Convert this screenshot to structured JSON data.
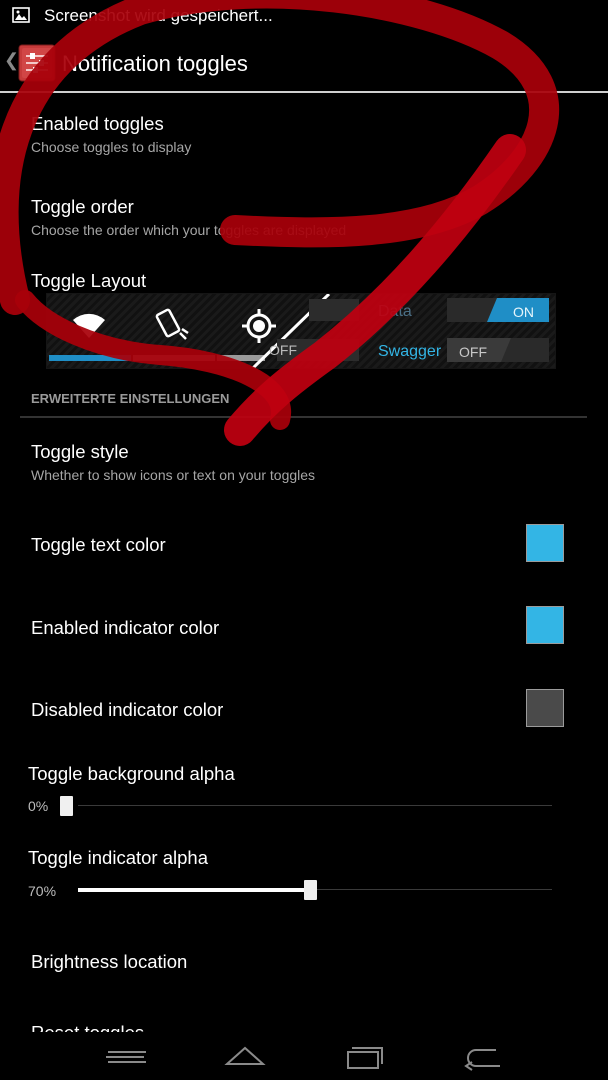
{
  "status_bar": {
    "notification_icon": "image-icon",
    "text": "Screenshot wird gespeichert..."
  },
  "action_bar": {
    "back_icon": "chevron-left-icon",
    "app_icon": "settings-sliders-icon",
    "title": "Notification toggles"
  },
  "prefs": {
    "enabled_toggles": {
      "title": "Enabled toggles",
      "summary": "Choose toggles to display"
    },
    "toggle_order": {
      "title": "Toggle order",
      "summary": "Choose the order which your toggles are displayed"
    },
    "toggle_layout": {
      "title": "Toggle Layout"
    }
  },
  "layout_preview": {
    "icons": [
      "wifi-icon",
      "rotation-icon",
      "location-icon"
    ],
    "off_label_1": "OFF",
    "data_label": "Data",
    "data_state": "ON",
    "swagger_label": "Swagger",
    "swagger_state": "OFF"
  },
  "advanced": {
    "header": "ERWEITERTE EINSTELLUNGEN",
    "toggle_style": {
      "title": "Toggle style",
      "summary": "Whether to show icons or text on your toggles"
    },
    "toggle_text_color": {
      "title": "Toggle text color",
      "color": "#33b5e5"
    },
    "enabled_indicator_color": {
      "title": "Enabled indicator color",
      "color": "#33b5e5"
    },
    "disabled_indicator_color": {
      "title": "Disabled indicator color",
      "color": "#4a4a4a"
    },
    "background_alpha": {
      "title": "Toggle background alpha",
      "value_label": "0%",
      "value": 0
    },
    "indicator_alpha": {
      "title": "Toggle indicator alpha",
      "value_label": "70%",
      "value": 70
    },
    "brightness_location": {
      "title": "Brightness location"
    },
    "reset_toggles": {
      "title": "Reset toggles"
    }
  },
  "nav_bar": {
    "menu_icon": "menu-icon",
    "home_icon": "home-icon",
    "recents_icon": "recents-icon",
    "back_icon": "back-arrow-icon"
  },
  "colors": {
    "accent": "#33b5e5",
    "annotation_red": "#b0000a",
    "category_header": "#9a9a9a"
  }
}
